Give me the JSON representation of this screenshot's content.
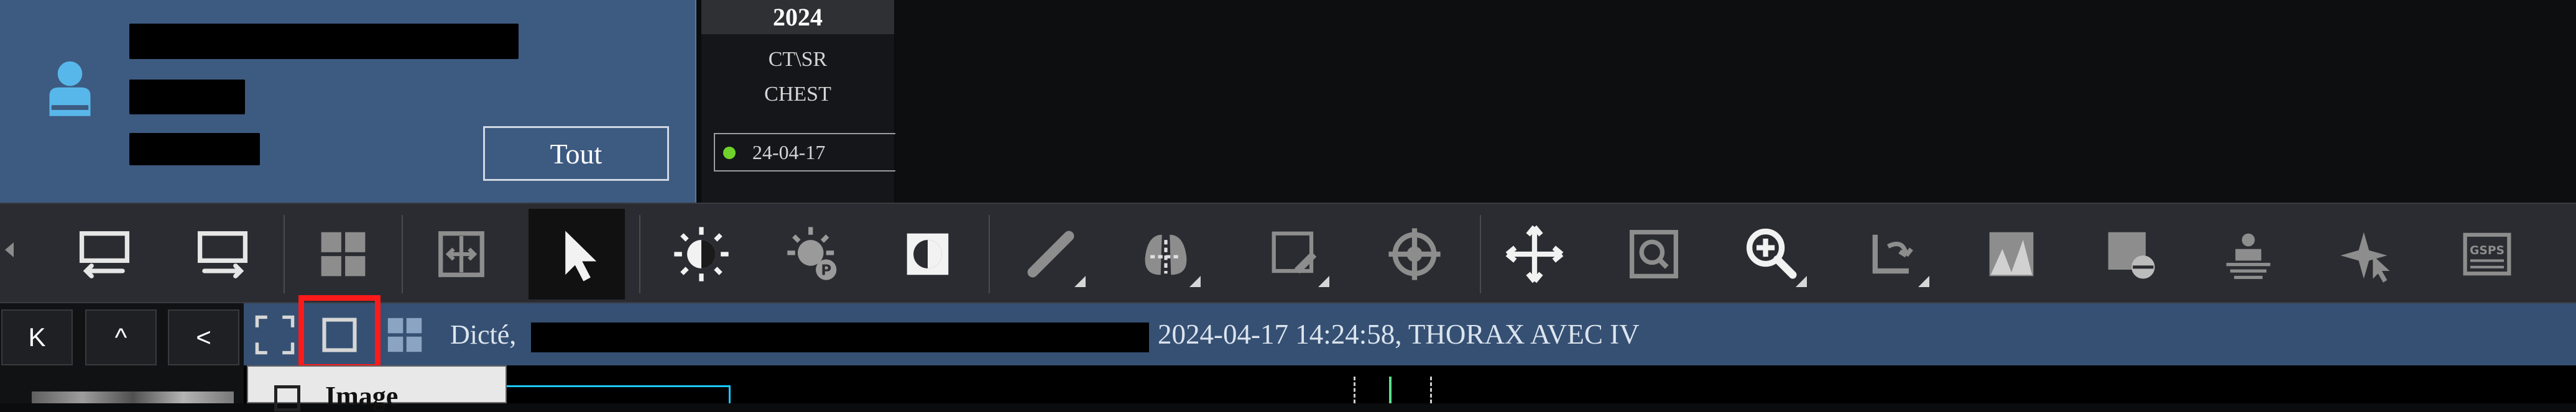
{
  "header": {
    "patient_panel": {
      "button_tout": "Tout"
    },
    "study": {
      "year": "2024",
      "modality": "CT\\SR",
      "body_part": "CHEST",
      "date": "24-04-17"
    }
  },
  "toolbar": {
    "icons": [
      "layout-previous-icon",
      "layout-next-icon",
      "grid-layout-icon",
      "fit-width-icon",
      "pointer-icon",
      "window-level-icon",
      "window-level-preset-icon",
      "invert-icon",
      "ruler-icon",
      "lung-measure-icon",
      "annotation-icon",
      "crosshair-icon",
      "pan-icon",
      "zoom-fit-icon",
      "zoom-icon",
      "rotate-icon",
      "volume-render-icon",
      "volume-render-settings-icon",
      "table-filter-icon",
      "cursor-sync-icon",
      "gsps-icon"
    ]
  },
  "status": {
    "prefix": "Dicté,",
    "info": "2024-04-17 14:24:58, THORAX AVEC IV"
  },
  "navigation": {
    "first": "K",
    "up": "^",
    "back": "<"
  },
  "popup": {
    "image_label": "Image"
  }
}
